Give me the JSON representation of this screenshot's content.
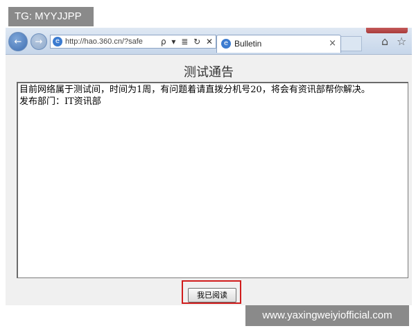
{
  "watermark": {
    "top_left": "TG: MYYJJPP",
    "bottom_right": "www.yaxingweiyiofficial.com"
  },
  "browser": {
    "address": "http://hao.360.cn/?safe",
    "address_tools": "ρ ▾ ≣ ↻ ✕",
    "tab_title": "Bulletin",
    "tab_close": "×",
    "back_icon": "←",
    "forward_icon": "→",
    "home_icon": "⌂",
    "favorites_icon": "☆",
    "site_icon": "e"
  },
  "page": {
    "title": "测试通告",
    "notice_lines": [
      "目前网络属于测试间，时间为1周，有问题着请直拨分机号20，将会有资讯部帮你解决。",
      "发布部门：IT资讯部"
    ],
    "button_label": "我已阅读",
    "highlight_color": "#d01c1c"
  }
}
